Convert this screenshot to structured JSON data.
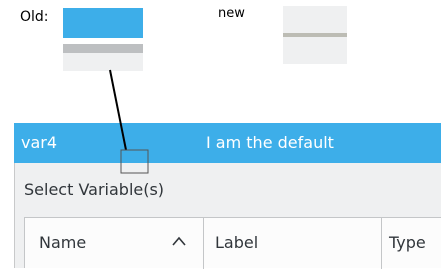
{
  "annotations": {
    "old_label": "Old:",
    "new_label": "new"
  },
  "dialog": {
    "title_left": "var4",
    "title_center": "I am the default",
    "heading": "Select Variable(s)",
    "columns": [
      {
        "label": "Name",
        "sorted": "ascending"
      },
      {
        "label": "Label"
      },
      {
        "label": "Type"
      }
    ]
  },
  "colors": {
    "accent": "#3daee9",
    "window_bg": "#eff0f1",
    "old_separator": "#bdbfc1",
    "new_separator": "#bcbcb4"
  },
  "icons": {
    "sort": "chevron-up-icon"
  }
}
